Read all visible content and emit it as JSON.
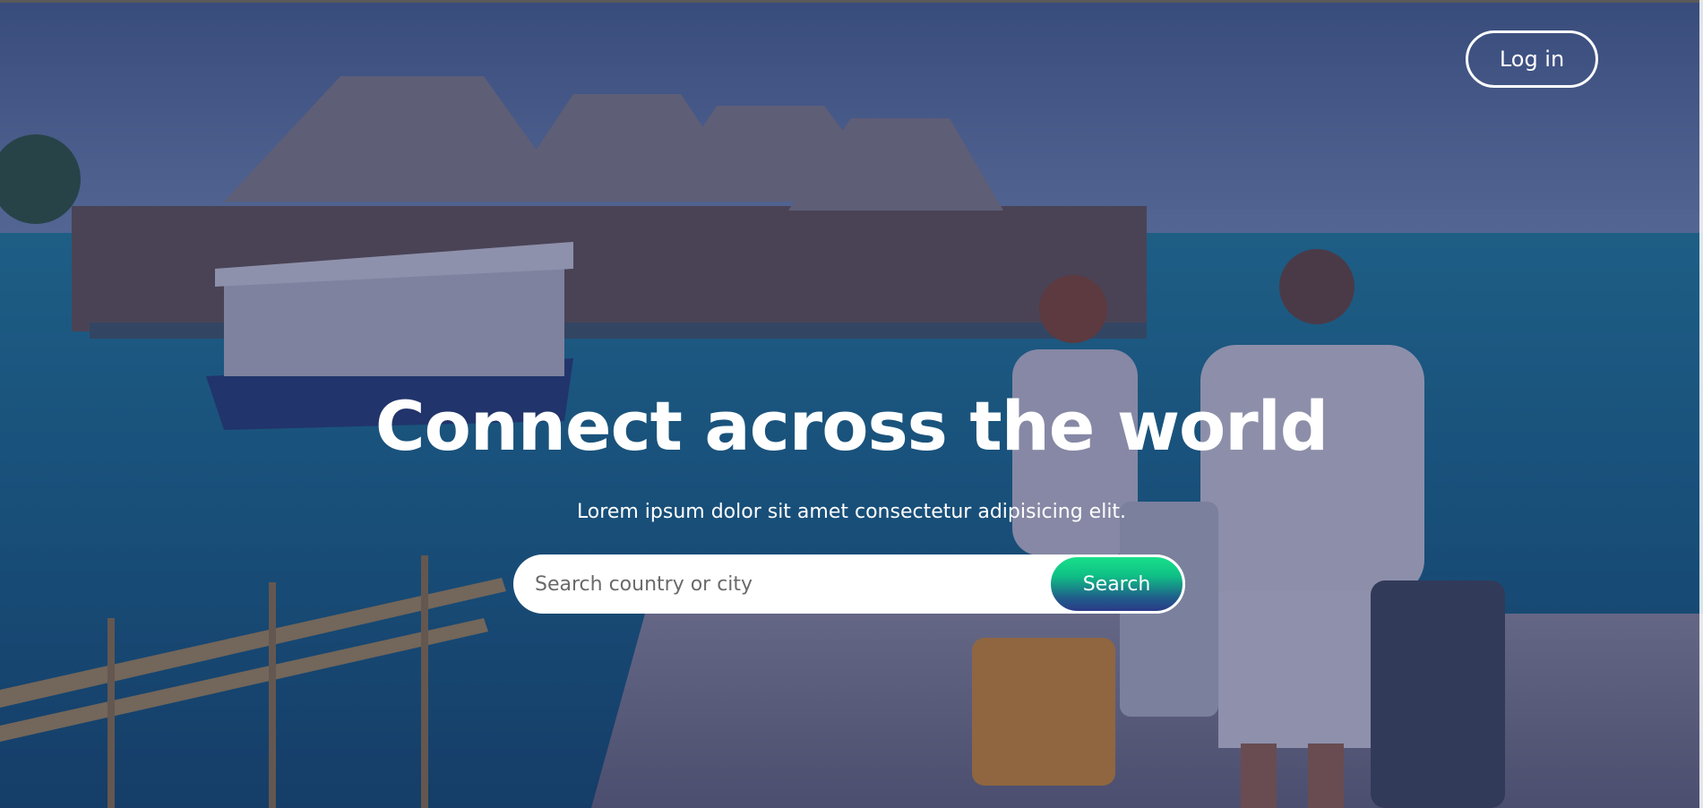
{
  "header": {
    "login_label": "Log in"
  },
  "hero": {
    "title": "Connect across the world",
    "subtitle": "Lorem ipsum dolor sit amet consectetur adipisicing elit.",
    "background_image": "tropical-resort-travelers-photo"
  },
  "search": {
    "placeholder": "Search country or city",
    "value": "",
    "button_label": "Search"
  },
  "colors": {
    "overlay": "#23285a",
    "search_button_top": "#19e08a",
    "search_button_bottom": "#2a3a88",
    "text": "#ffffff"
  }
}
